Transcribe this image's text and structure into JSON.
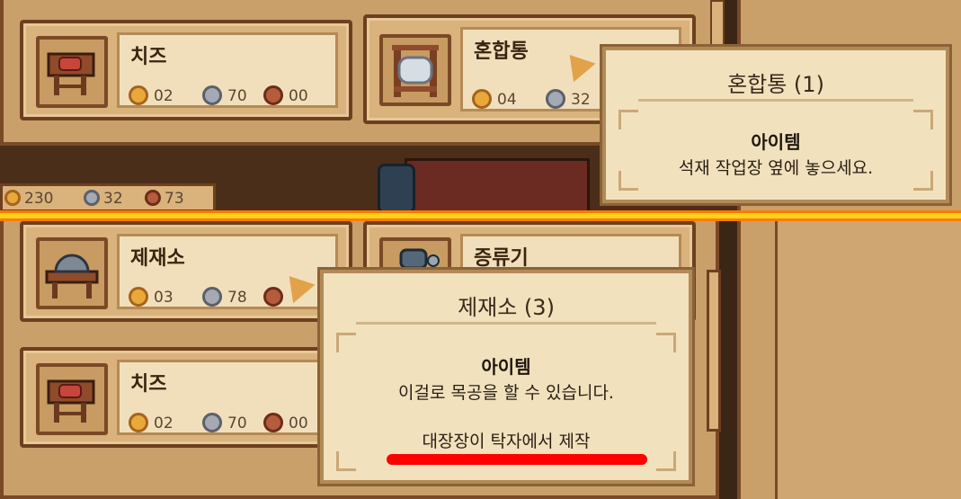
{
  "cards": {
    "cheese_top": {
      "name": "치즈",
      "gold": "02",
      "silver": "70",
      "copper": "00"
    },
    "mixer": {
      "name": "혼합통",
      "gold": "04",
      "silver": "32"
    },
    "carpentry": {
      "name": "제재소",
      "gold": "03",
      "silver": "78"
    },
    "distiller": {
      "name": "증류기"
    },
    "cheese_bottom": {
      "name": "치즈",
      "gold": "02",
      "silver": "70",
      "copper": "00"
    }
  },
  "hud": {
    "gold": "230",
    "silver": "32",
    "copper": "73"
  },
  "tooltip_mixer": {
    "title": "혼합통 (1)",
    "heading": "아이템",
    "description": "석재 작업장 옆에 놓으세요."
  },
  "tooltip_carpentry": {
    "title": "제재소 (3)",
    "heading": "아이템",
    "description": "이걸로 목공을 할 수 있습니다.",
    "craft_note": "대장장이 탁자에서 제작"
  },
  "colors": {
    "divider_yellow": "#ffd21a",
    "divider_orange": "#ff7a00",
    "underline_red": "#ff0000",
    "gold_coin": "#e9a93a",
    "silver_coin": "#a4a9b3",
    "copper_coin": "#b45c3c"
  },
  "icons": [
    "cheese-icon",
    "mixer-icon",
    "sawmill-icon",
    "distiller-icon",
    "gold-coin-icon",
    "silver-coin-icon",
    "copper-coin-icon",
    "cursor-arrow-icon"
  ]
}
